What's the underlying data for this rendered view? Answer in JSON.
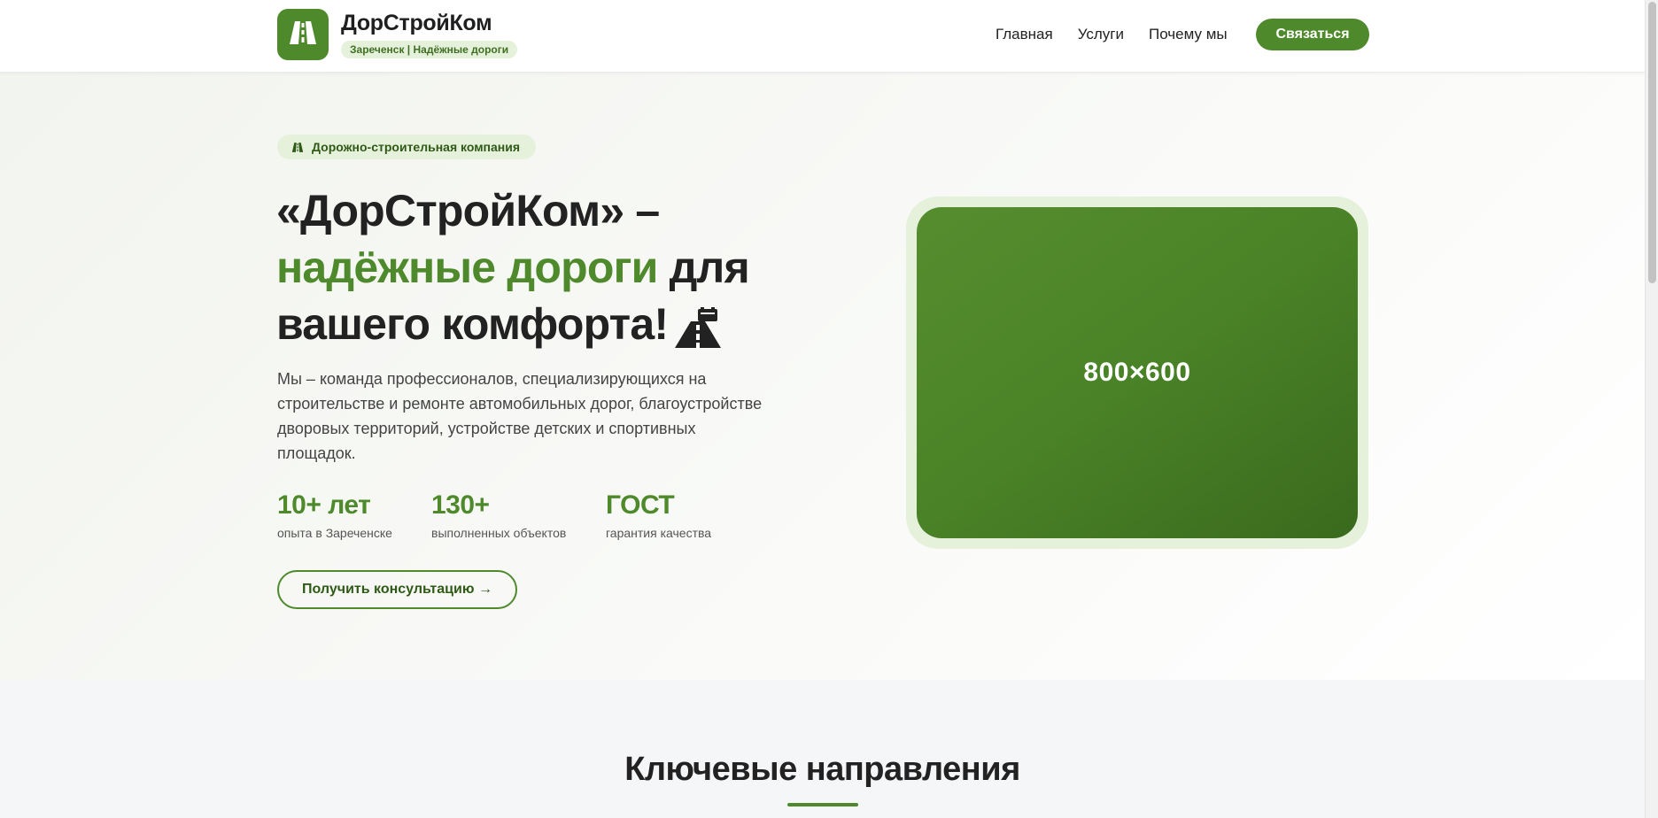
{
  "header": {
    "brand_name": "ДорСтройКом",
    "brand_tagline": "Зареченск | Надёжные дороги",
    "logo_icon": "road-icon",
    "nav": [
      {
        "label": "Главная"
      },
      {
        "label": "Услуги"
      },
      {
        "label": "Почему мы"
      }
    ],
    "cta_label": "Связаться"
  },
  "hero": {
    "badge_icon": "road-icon",
    "badge_text": "Дорожно-строительная компания",
    "title_part1": "«ДорСтройКом» –",
    "title_highlight": "надёжные дороги",
    "title_part2": " для вашего комфорта!",
    "title_icon": "road-construction-icon",
    "description": "Мы – команда профессионалов, специализирующихся на строительстве и ремонте автомобильных дорог, благоустройстве дворовых территорий, устройстве детских и спортивных площадок.",
    "stats": [
      {
        "value": "10+ лет",
        "label": "опыта в Зареченске"
      },
      {
        "value": "130+",
        "label": "выполненных объектов"
      },
      {
        "value": "ГОСТ",
        "label": "гарантия качества"
      }
    ],
    "cta_label": "Получить консультацию",
    "cta_arrow": "→",
    "image_placeholder": "800×600"
  },
  "section": {
    "title": "Ключевые направления"
  },
  "colors": {
    "brand_green": "#4e8a2c",
    "light_green": "#e6f1dc",
    "dark_text": "#222222"
  }
}
